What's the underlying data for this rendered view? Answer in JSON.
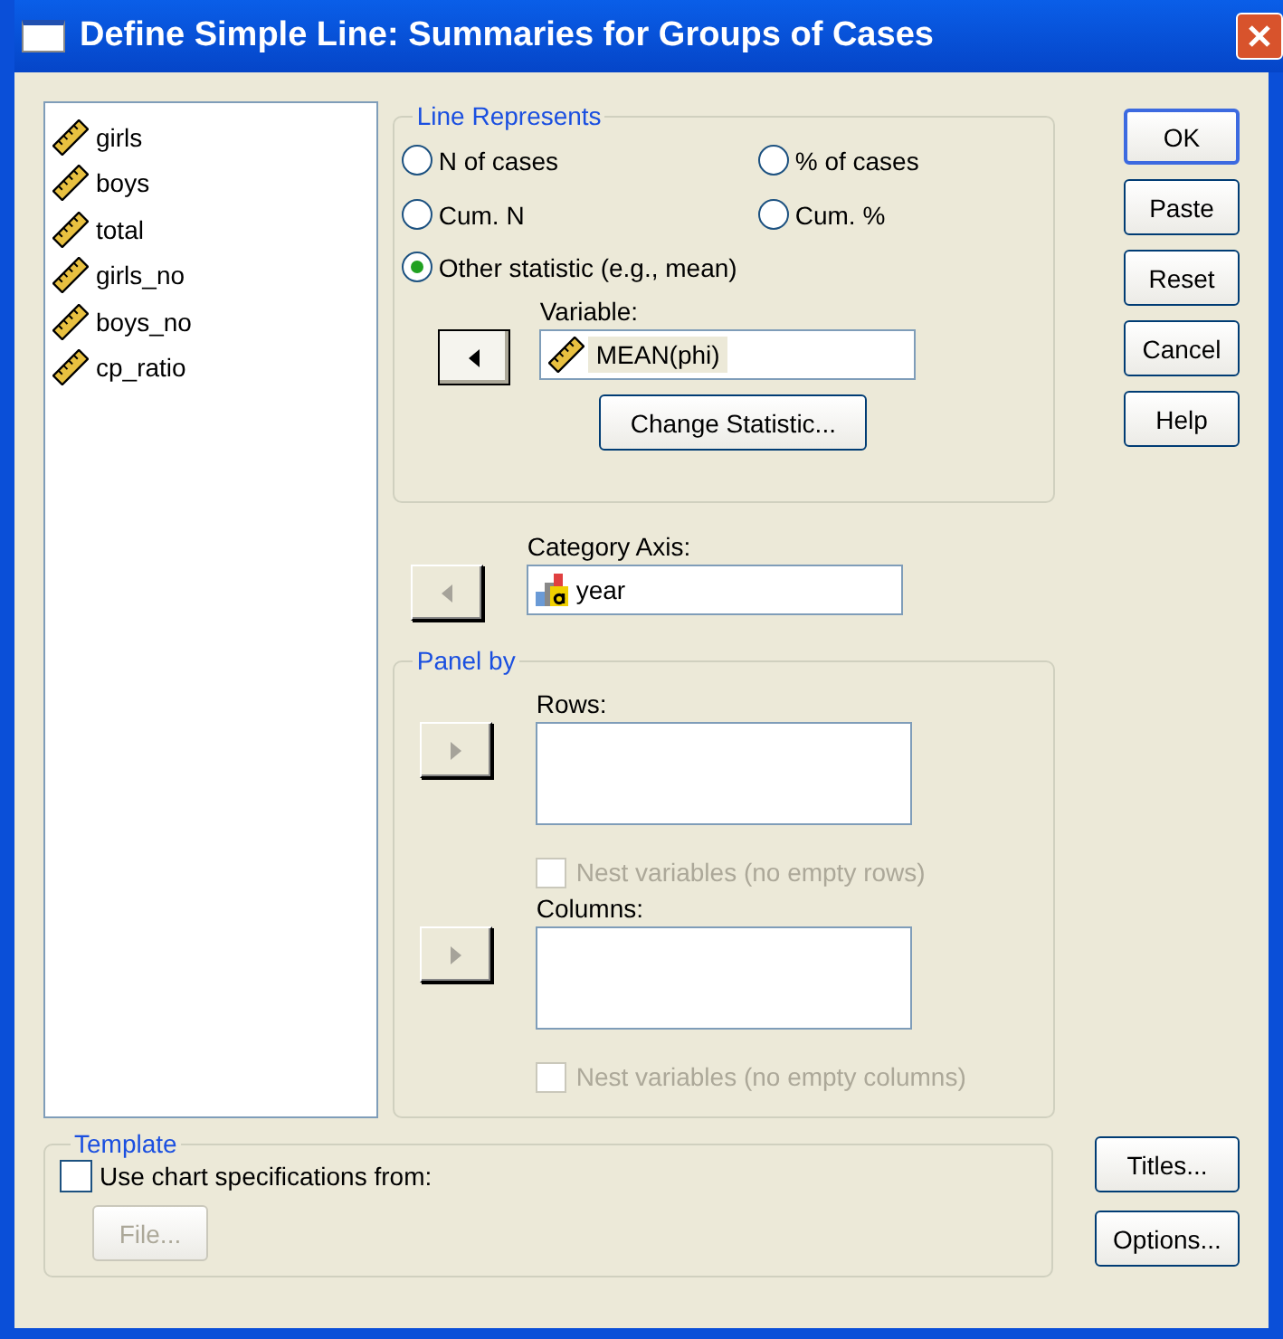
{
  "window": {
    "title": "Define Simple Line: Summaries for Groups of Cases"
  },
  "variables": [
    {
      "name": "girls"
    },
    {
      "name": "boys"
    },
    {
      "name": "total"
    },
    {
      "name": "girls_no"
    },
    {
      "name": "boys_no"
    },
    {
      "name": "cp_ratio"
    }
  ],
  "line_represents": {
    "title": "Line Represents",
    "options": [
      {
        "label": "N of cases",
        "selected": false
      },
      {
        "label": "% of cases",
        "selected": false
      },
      {
        "label": "Cum. N",
        "selected": false
      },
      {
        "label": "Cum. %",
        "selected": false
      },
      {
        "label": "Other statistic (e.g., mean)",
        "selected": true
      }
    ],
    "variable": {
      "label": "Variable:",
      "value": "MEAN(phi)",
      "arrow": {
        "kind": "left",
        "disabled": false
      }
    },
    "change_button": "Change Statistic..."
  },
  "category_axis": {
    "label": "Category Axis:",
    "value": "year",
    "arrow": {
      "kind": "left",
      "disabled": true
    }
  },
  "panel_by": {
    "title": "Panel by",
    "targets": [
      {
        "label": "Rows:",
        "arrow": {
          "kind": "right",
          "disabled": true
        },
        "nest": {
          "label": "Nest variables (no empty rows)",
          "checked": false,
          "disabled": true
        }
      },
      {
        "label": "Columns:",
        "arrow": {
          "kind": "right",
          "disabled": true
        },
        "nest": {
          "label": "Nest variables (no empty columns)",
          "checked": false,
          "disabled": true
        }
      }
    ]
  },
  "template": {
    "title": "Template",
    "checkbox": {
      "label": "Use chart specifications from:",
      "checked": false
    },
    "file_button": {
      "label": "File...",
      "disabled": true
    }
  },
  "buttons": [
    {
      "label": "OK",
      "default": true
    },
    {
      "label": "Paste",
      "default": false
    },
    {
      "label": "Reset",
      "default": false
    },
    {
      "label": "Cancel",
      "default": false
    },
    {
      "label": "Help",
      "default": false
    }
  ],
  "bottom_buttons": [
    {
      "label": "Titles..."
    },
    {
      "label": "Options..."
    }
  ]
}
